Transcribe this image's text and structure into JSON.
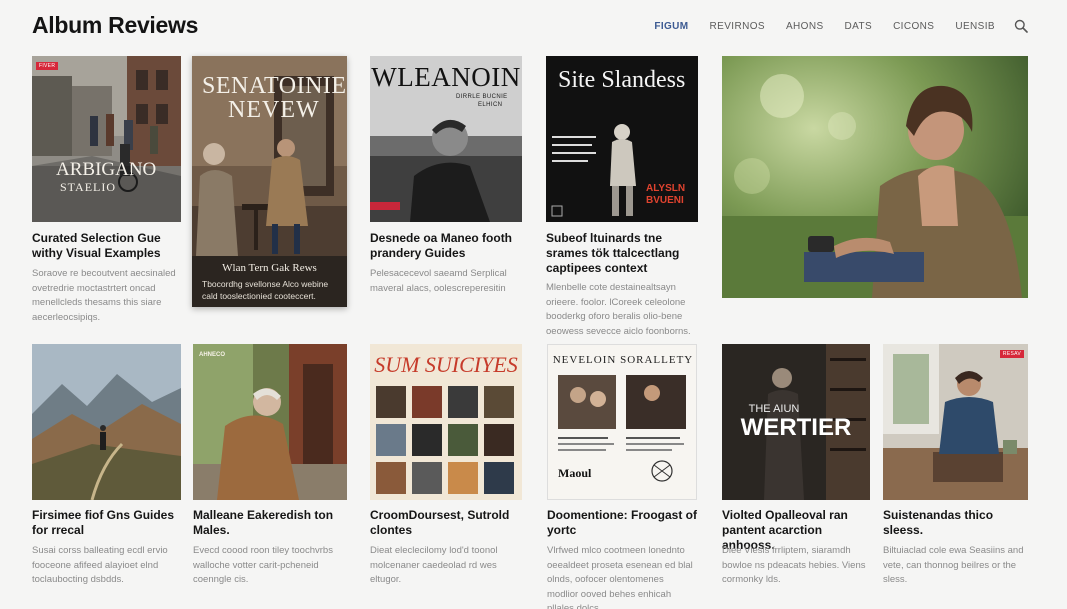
{
  "header": {
    "title": "Album Reviews",
    "nav": [
      "FIGUM",
      "REVIRNOS",
      "AHONS",
      "DATS",
      "CICONS",
      "UENSIB"
    ],
    "active_index": 0,
    "search_icon": "search-icon"
  },
  "cards": [
    {
      "cover_text": [
        "ARBIGANO",
        "STAELIO"
      ],
      "badge": "FIVER",
      "title": "Curated Selection Gue withy Visual Examples",
      "desc": "Soraove re becoutvent aecsinaled ovetredrie moctastrtert oncad menellcleds thesams this siare aecerleocsipiqs."
    },
    {
      "cover_text": [
        "SENATOINIE",
        "NEVEW"
      ],
      "caption_title": "Wlan Tern Gak Rews",
      "caption_desc": "Tbocordhg svellonse Alco webine cald tooslectionied cooteccert.",
      "title": "",
      "desc": ""
    },
    {
      "cover_text": [
        "WLEANOIN",
        "DIRRLE BUCNIE",
        "ELHICN"
      ],
      "title": "Desnede oa Maneo footh prandery Guides",
      "desc": "Pelesacecevol saeamd Serplical maveral alacs, oolescreperesitin"
    },
    {
      "cover_text": [
        "Site Slandess",
        "ALYSLN",
        "BVUENI"
      ],
      "title": "Subeof ltuinards tne srames tök ttalcectlang captipees context",
      "desc": "Mlenbelle cote destainealtsayn orieere. foolor. lCoreek celeolone booderkg oforo beralis olio-bene oeowess sevecce aiclo foonborns."
    },
    {
      "title": "",
      "desc": ""
    },
    {
      "title": "Firsimee fiof Gns Guides for rrecal",
      "desc": "Susai corss balleating ecdl ervio fooceone afifeed alayioet elnd toclaubocting dsbdds."
    },
    {
      "cover_text": [
        "AHNECO"
      ],
      "title": "Malleane Eakeredish ton Males.",
      "desc": "Evecd coood roon tiley toochvrbs walloche votter carit-pcheneid coenngle cis."
    },
    {
      "cover_text": [
        "SUM SUICIYES"
      ],
      "title": "CroomDoursest, Sutrold clontes",
      "desc": "Dieat eleclecilomy lod'd toonol molcenaner caedeolad rd wes eltugor."
    },
    {
      "cover_text": [
        "NEVELOIN SORALLETY",
        "Maoul"
      ],
      "title": "Doomentione: Froogast of yortc",
      "desc": "Vlrfwed mlco cootmeen lonednto oeealdeet proseta esenean ed blal olnds, oofocer olentomenes modlior ooved behes enhicah pllales dolcs."
    },
    {
      "cover_text": [
        "THE AIUN",
        "WERTIER"
      ],
      "title": "Violted Opalleoval ran pantent acarction anhooss.",
      "desc": "Dlee Viesls frrliptem, siaramdh bowloe ns pdeacats hebies. Viens cormonky lds."
    },
    {
      "badge": "RESAV",
      "title": "Suistenandas thico sleess.",
      "desc": "Biltuiaclad cole ewa Seasiins and vete, can thonnog beilres or the sless."
    }
  ]
}
